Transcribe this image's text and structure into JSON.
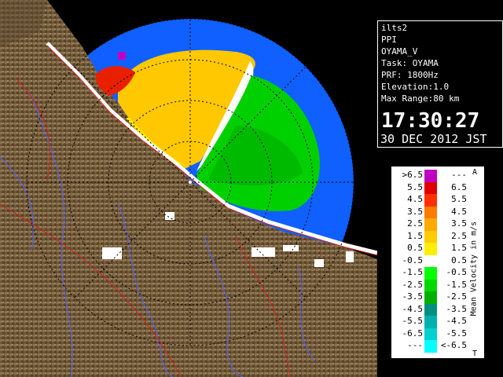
{
  "info": {
    "lines": [
      "ilts2",
      "PPI",
      "OYAMA_V",
      "Task: OYAMA",
      "PRF: 1800Hz",
      "Elevation:1.0",
      "Max Range:80 km"
    ],
    "time": "17:30:27",
    "date": "30 DEC 2012 JST"
  },
  "legend": {
    "title": "Mean Velocity in m/s",
    "top_marker": "A",
    "bottom_marker": "T",
    "rows": [
      {
        "lo": ">6.5",
        "hi": "---",
        "color": "#c000c0"
      },
      {
        "lo": "5.5",
        "hi": "6.5",
        "color": "#e00000"
      },
      {
        "lo": "4.5",
        "hi": "5.5",
        "color": "#ff3000"
      },
      {
        "lo": "3.5",
        "hi": "4.5",
        "color": "#ff7a00"
      },
      {
        "lo": "2.5",
        "hi": "3.5",
        "color": "#ffa800"
      },
      {
        "lo": "1.5",
        "hi": "2.5",
        "color": "#ffcc00"
      },
      {
        "lo": "0.5",
        "hi": "1.5",
        "color": "#ffee00"
      },
      {
        "lo": "-0.5",
        "hi": "0.5",
        "color": "#ffffff"
      },
      {
        "lo": "-1.5",
        "hi": "-0.5",
        "color": "#00ff00"
      },
      {
        "lo": "-2.5",
        "hi": "-1.5",
        "color": "#00d800"
      },
      {
        "lo": "-3.5",
        "hi": "-2.5",
        "color": "#00b000"
      },
      {
        "lo": "-4.5",
        "hi": "-3.5",
        "color": "#009080"
      },
      {
        "lo": "-5.5",
        "hi": "-4.5",
        "color": "#00b0b0"
      },
      {
        "lo": "-6.5",
        "hi": "-5.5",
        "color": "#00d0d0"
      },
      {
        "lo": "---",
        "hi": "<-6.5",
        "color": "#00ffff"
      }
    ]
  },
  "map": {
    "sea_color": "#1060ff",
    "land_color": "#7a6240",
    "range_ring_color": "#000000"
  }
}
